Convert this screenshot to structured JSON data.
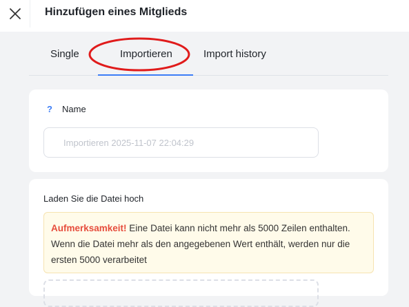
{
  "header": {
    "title": "Hinzufügen eines Mitglieds",
    "close_icon": "close-icon"
  },
  "tabs": [
    {
      "label": "Single",
      "active": false
    },
    {
      "label": "Importieren",
      "active": true
    },
    {
      "label": "Import history",
      "active": false
    }
  ],
  "name_section": {
    "help_icon": "?",
    "label": "Name",
    "placeholder": "Importieren 2025-11-07 22:04:29"
  },
  "upload_section": {
    "title": "Laden Sie die Datei hoch",
    "warning_strong": "Aufmerksamkeit!",
    "warning_text": " Eine Datei kann nicht mehr als 5000 Zeilen enthalten. Wenn die Datei mehr als den angegebenen Wert enthält, werden nur die ersten 5000 verarbeitet"
  },
  "colors": {
    "accent": "#3b7cf6",
    "annotation": "#e01b1b",
    "warning": "#e64c3c"
  }
}
